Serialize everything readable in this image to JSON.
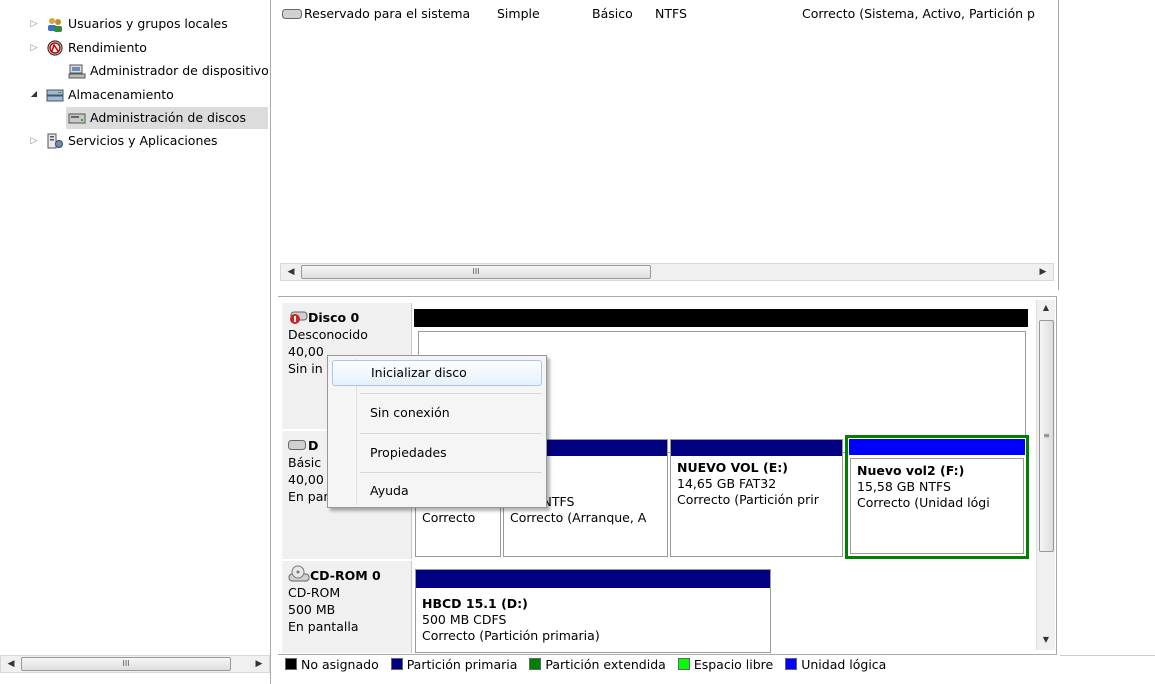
{
  "tree": {
    "items": [
      {
        "label": "Usuarios y grupos locales",
        "icon": "users-icon",
        "expand": "▷"
      },
      {
        "label": "Rendimiento",
        "icon": "performance-icon",
        "expand": "▷"
      },
      {
        "label": "Administrador de dispositivos",
        "icon": "device-manager-icon",
        "expand": ""
      },
      {
        "label": "Almacenamiento",
        "icon": "storage-icon",
        "expand": "◢"
      },
      {
        "label": "Administración de discos",
        "icon": "disk-management-icon",
        "expand": ""
      },
      {
        "label": "Servicios y Aplicaciones",
        "icon": "services-icon",
        "expand": "▷"
      }
    ],
    "scroll_thumb": "III"
  },
  "volume_row": {
    "name": "Reservado para el sistema",
    "layout": "Simple",
    "type": "Básico",
    "fs": "NTFS",
    "status": "Correcto (Sistema, Activo, Partición p"
  },
  "volume_scroll_thumb": "III",
  "disks": {
    "disk0": {
      "title": "Disco 0",
      "l1": "Desconocido",
      "l2": "40,00",
      "l3": "Sin in"
    },
    "disk1": {
      "title": "D",
      "l1": "Básic",
      "l2": "40,00",
      "l3": "En pantalla"
    },
    "cdrom": {
      "title": "CD-ROM 0",
      "l1": "CD-ROM",
      "l2": "500 MB",
      "l3": "En pantalla"
    }
  },
  "partitions": {
    "p1": {
      "status": "Correcto"
    },
    "p2": {
      "size": "B NTFS",
      "status": "Correcto (Arranque, A"
    },
    "p3": {
      "name": "NUEVO VOL  (E:)",
      "size": "14,65 GB FAT32",
      "status": "Correcto (Partición prir"
    },
    "p4": {
      "name": "Nuevo vol2  (F:)",
      "size": "15,58 GB NTFS",
      "status": "Correcto (Unidad lógi"
    },
    "cd": {
      "name": "HBCD 15.1  (D:)",
      "size": "500 MB CDFS",
      "status": "Correcto (Partición primaria)"
    }
  },
  "context_menu": {
    "items": [
      "Inicializar disco",
      "Sin conexión",
      "Propiedades",
      "Ayuda"
    ]
  },
  "legend": {
    "items": [
      {
        "label": "No asignado",
        "color": "#000000"
      },
      {
        "label": "Partición primaria",
        "color": "#000080"
      },
      {
        "label": "Partición extendida",
        "color": "#008000"
      },
      {
        "label": "Espacio libre",
        "color": "#00ff00"
      },
      {
        "label": "Unidad lógica",
        "color": "#0000ff"
      }
    ]
  },
  "colors": {
    "unallocated": "#000000",
    "primary": "#000080",
    "extended": "#008000",
    "logical": "#0000ff"
  }
}
